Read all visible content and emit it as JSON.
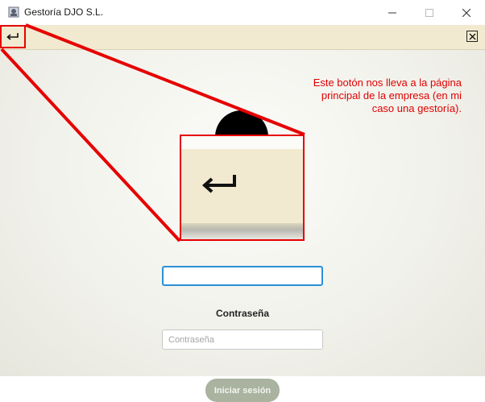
{
  "window": {
    "title": "Gestoría DJO S.L.",
    "app_icon": "app-logo-icon",
    "minimize_icon": "minimize-icon",
    "maximize_icon": "maximize-icon",
    "close_icon": "close-icon"
  },
  "toolbar": {
    "back_icon": "return-arrow-icon",
    "close_icon": "close-box-icon",
    "background": "#f1ead0"
  },
  "login": {
    "avatar_icon": "user-avatar-icon",
    "password_label": "Contraseña",
    "password_placeholder": "Contraseña",
    "login_button": "Iniciar sesión",
    "button_color": "#a9b3a0",
    "focus_color": "#2b8fd6"
  },
  "annotation": {
    "text": "Este botón nos lleva a la página principal de la empresa (en mi caso una gestoría).",
    "color": "#e00000"
  }
}
